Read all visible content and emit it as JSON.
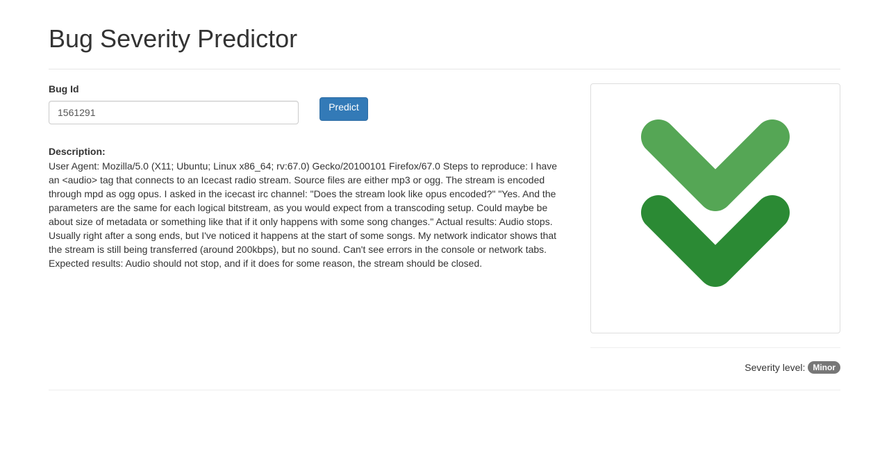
{
  "page": {
    "title": "Bug Severity Predictor"
  },
  "form": {
    "bug_id_label": "Bug Id",
    "bug_id_value": "1561291",
    "predict_label": "Predict"
  },
  "description": {
    "heading": "Description:",
    "text": "User Agent: Mozilla/5.0 (X11; Ubuntu; Linux x86_64; rv:67.0) Gecko/20100101 Firefox/67.0 Steps to reproduce: I have an <audio> tag that connects to an Icecast radio stream. Source files are either mp3 or ogg. The stream is encoded through mpd as ogg opus. I asked in the icecast irc channel: \"Does the stream look like opus encoded?\" \"Yes. And the parameters are the same for each logical bitstream, as you would expect from a transcoding setup. Could maybe be about size of metadata or something like that if it only happens with some song changes.\" Actual results: Audio stops. Usually right after a song ends, but I've noticed it happens at the start of some songs. My network indicator shows that the stream is still being transferred (around 200kbps), but no sound. Can't see errors in the console or network tabs. Expected results: Audio should not stop, and if it does for some reason, the stream should be closed."
  },
  "severity": {
    "label": "Severity level:",
    "value": "Minor",
    "icon": "double-chevron-down-icon"
  },
  "colors": {
    "chevron_light": "#55a655",
    "chevron_dark": "#2b8a34",
    "primary_button": "#337ab7",
    "badge": "#777777"
  }
}
